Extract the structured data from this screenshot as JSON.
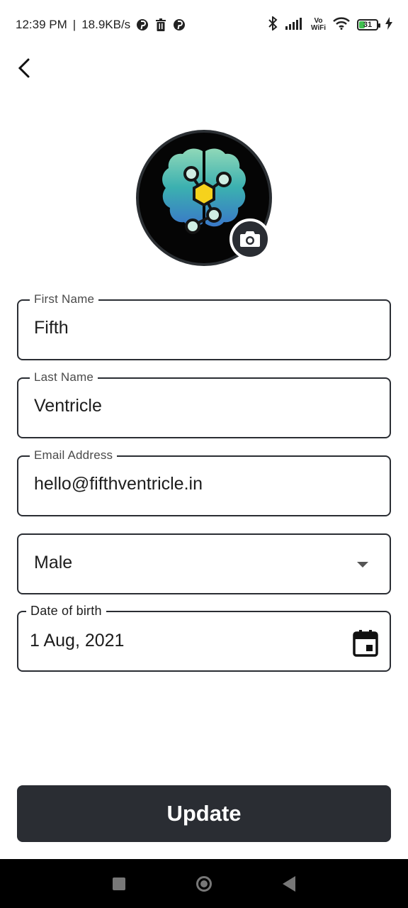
{
  "status_bar": {
    "time": "12:39 PM",
    "separator": "|",
    "speed": "18.9KB/s",
    "vo": "Vo",
    "wifi_text": "WiFi",
    "battery": "31",
    "icons": [
      "pinterest-icon",
      "trash-icon",
      "pinterest-icon",
      "bluetooth-icon",
      "signal-icon",
      "vowifi-icon",
      "wifi-icon",
      "battery-icon",
      "charging-icon"
    ]
  },
  "header": {
    "back_icon": "chevron-left-icon"
  },
  "profile": {
    "avatar_icon": "brain-molecule-logo",
    "camera_icon": "camera-icon"
  },
  "form": {
    "first_name": {
      "label": "First Name",
      "value": "Fifth"
    },
    "last_name": {
      "label": "Last Name",
      "value": "Ventricle"
    },
    "email": {
      "label": "Email Address",
      "value": "hello@fifthventricle.in"
    },
    "gender": {
      "value": "Male"
    },
    "dob": {
      "label": "Date of birth",
      "value": "1 Aug, 2021"
    }
  },
  "actions": {
    "update_label": "Update"
  },
  "colors": {
    "primary": "#2a2d33",
    "logo_yellow": "#f6d21c",
    "logo_teal": "#3bb0b0",
    "battery_green": "#3fbf4f"
  }
}
